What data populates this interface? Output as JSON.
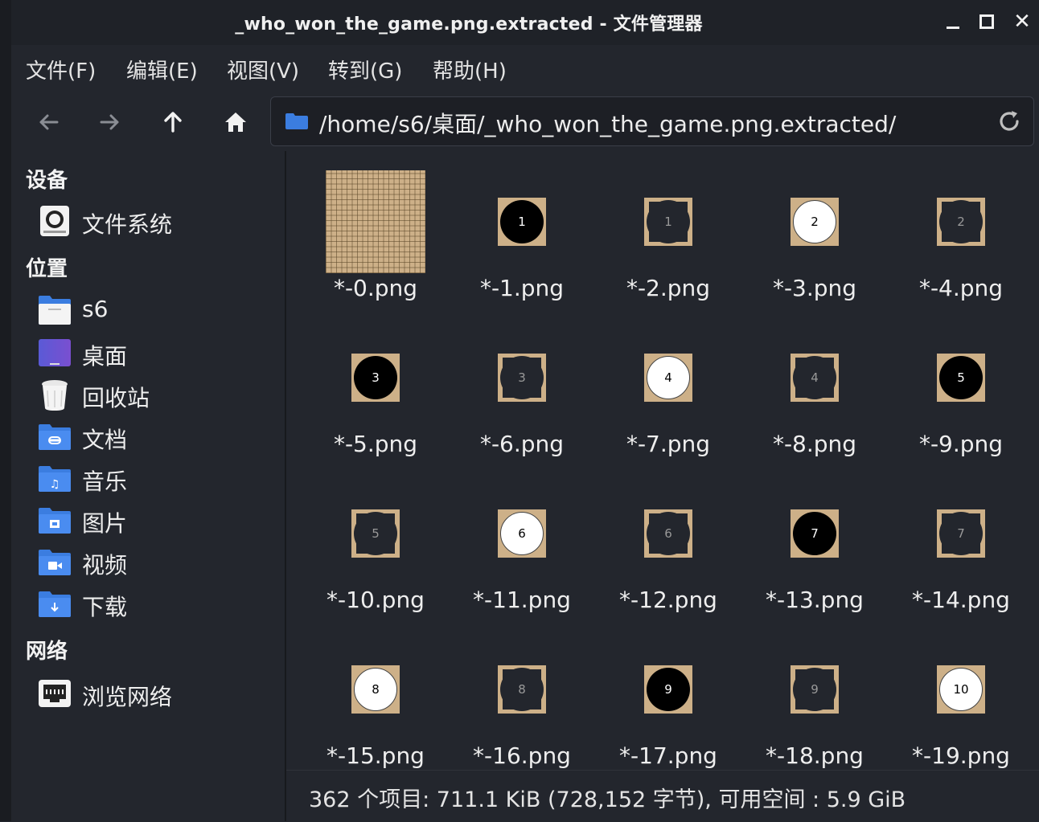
{
  "window": {
    "title": "_who_won_the_game.png.extracted - 文件管理器"
  },
  "menu": [
    "文件(F)",
    "编辑(E)",
    "视图(V)",
    "转到(G)",
    "帮助(H)"
  ],
  "toolbar": {
    "path": "/home/s6/桌面/_who_won_the_game.png.extracted/"
  },
  "sidebar": {
    "devices_heading": "设备",
    "devices": [
      {
        "label": "文件系统",
        "icon": "drive-icon"
      }
    ],
    "places_heading": "位置",
    "places": [
      {
        "label": "s6",
        "icon": "home-folder-icon"
      },
      {
        "label": "桌面",
        "icon": "desktop-icon"
      },
      {
        "label": "回收站",
        "icon": "trash-icon"
      },
      {
        "label": "文档",
        "icon": "documents-folder-icon"
      },
      {
        "label": "音乐",
        "icon": "music-folder-icon"
      },
      {
        "label": "图片",
        "icon": "pictures-folder-icon"
      },
      {
        "label": "视频",
        "icon": "videos-folder-icon"
      },
      {
        "label": "下载",
        "icon": "downloads-folder-icon"
      }
    ],
    "network_heading": "网络",
    "network": [
      {
        "label": "浏览网络",
        "icon": "network-icon"
      }
    ]
  },
  "files": [
    {
      "name": "*-0.png",
      "kind": "board"
    },
    {
      "name": "*-1.png",
      "kind": "black",
      "num": "1"
    },
    {
      "name": "*-2.png",
      "kind": "ghost",
      "num": "1"
    },
    {
      "name": "*-3.png",
      "kind": "white",
      "num": "2"
    },
    {
      "name": "*-4.png",
      "kind": "ghost",
      "num": "2"
    },
    {
      "name": "*-5.png",
      "kind": "black",
      "num": "3"
    },
    {
      "name": "*-6.png",
      "kind": "ghost",
      "num": "3"
    },
    {
      "name": "*-7.png",
      "kind": "white",
      "num": "4"
    },
    {
      "name": "*-8.png",
      "kind": "ghost",
      "num": "4"
    },
    {
      "name": "*-9.png",
      "kind": "black",
      "num": "5"
    },
    {
      "name": "*-10.png",
      "kind": "ghost",
      "num": "5"
    },
    {
      "name": "*-11.png",
      "kind": "white",
      "num": "6"
    },
    {
      "name": "*-12.png",
      "kind": "ghost",
      "num": "6"
    },
    {
      "name": "*-13.png",
      "kind": "black",
      "num": "7"
    },
    {
      "name": "*-14.png",
      "kind": "ghost",
      "num": "7"
    },
    {
      "name": "*-15.png",
      "kind": "white",
      "num": "8"
    },
    {
      "name": "*-16.png",
      "kind": "ghost",
      "num": "8"
    },
    {
      "name": "*-17.png",
      "kind": "black",
      "num": "9"
    },
    {
      "name": "*-18.png",
      "kind": "ghost",
      "num": "9"
    },
    {
      "name": "*-19.png",
      "kind": "white",
      "num": "10"
    }
  ],
  "status": "362 个项目: 711.1 KiB (728,152 字节), 可用空间 : 5.9 GiB",
  "colors": {
    "folder": "#3b7de0",
    "board": "#cdb088",
    "background": "#23262d"
  }
}
